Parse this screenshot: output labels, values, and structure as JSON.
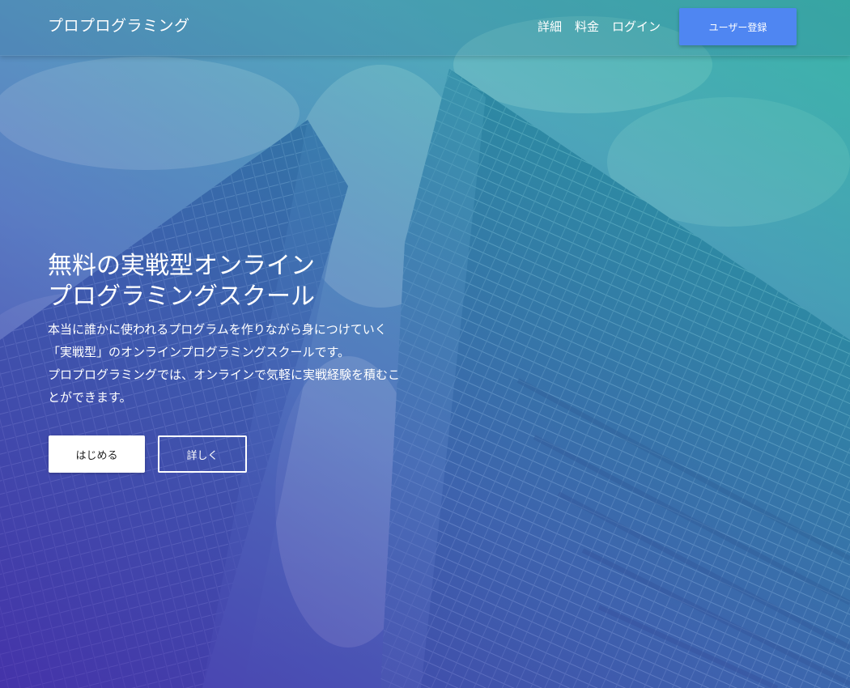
{
  "navbar": {
    "brand": "プロプログラミング",
    "links": [
      {
        "label": "詳細"
      },
      {
        "label": "料金"
      },
      {
        "label": "ログイン"
      }
    ],
    "register_label": "ユーザー登録"
  },
  "hero": {
    "headline": [
      "無料の実戦型オンライン",
      "プログラミングスクール"
    ],
    "lead": [
      "本当に誰かに使われるプログラムを作りながら身につけていく",
      "「実戦型」のオンラインプログラミングスクールです。",
      "プロプログラミングでは、オンラインで気軽に実戦経験を積むこ",
      "とができます。"
    ],
    "start_label": "はじめる",
    "more_label": "詳しく"
  },
  "colors": {
    "accent_button": "#4f86f2",
    "overlay_start": "#4628aa",
    "overlay_end": "#1eb496"
  }
}
